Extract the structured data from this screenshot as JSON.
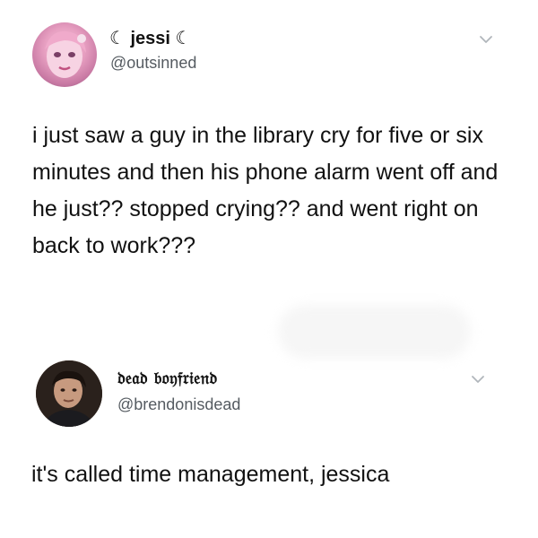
{
  "tweets": [
    {
      "display_name": "jessi",
      "name_prefix_glyph": "☾",
      "name_suffix_glyph": "☾",
      "handle": "@outsinned",
      "text": "i just saw a guy in the library cry for five or six minutes and then his phone alarm went off and he just?? stopped crying?? and went right on back to work???",
      "avatar_icon": "pink-doll-avatar",
      "menu_icon": "chevron-down-icon"
    },
    {
      "display_name": "𝔡𝔢𝔞𝔡 𝔟𝔬𝔶𝔣𝔯𝔦𝔢𝔫𝔡",
      "handle": "@brendonisdead",
      "text": "it's called time management, jessica",
      "avatar_icon": "person-photo-avatar",
      "menu_icon": "chevron-down-icon"
    }
  ],
  "colors": {
    "text": "#111111",
    "handle": "#555b61",
    "chevron": "#b0b6bb",
    "background": "#ffffff"
  }
}
